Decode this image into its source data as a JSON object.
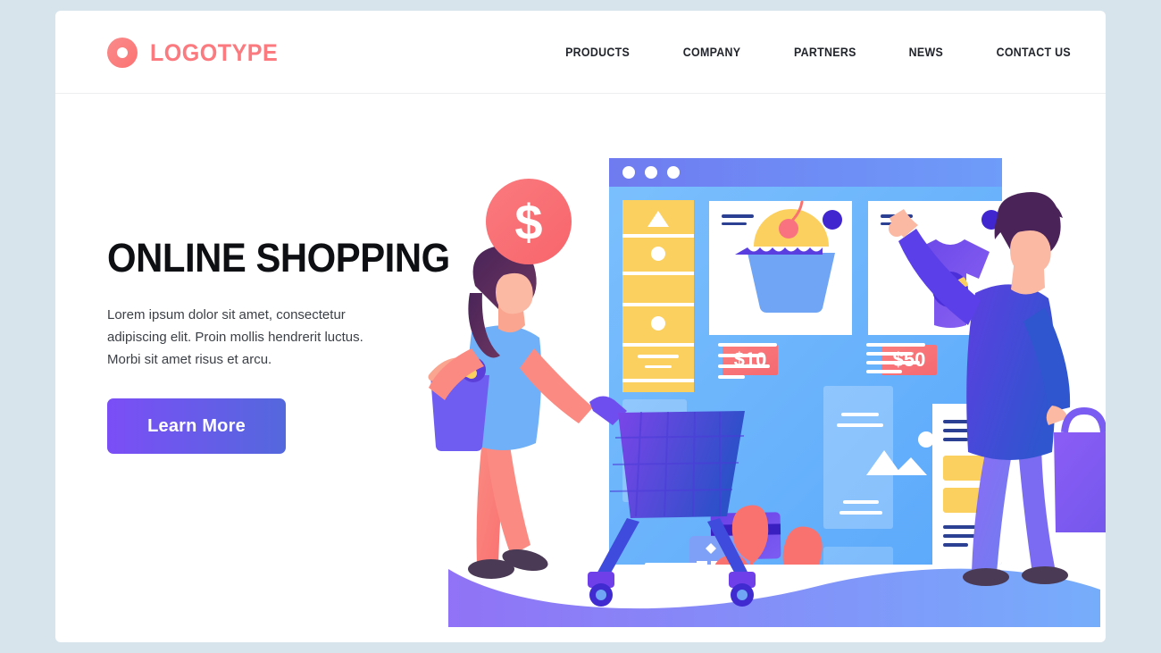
{
  "theme": {
    "page_background": "#d8e4ec",
    "card_background": "#ffffff",
    "brand_color": "#fb7a7f",
    "accent_purple": "#7b4ef6",
    "accent_blue": "#5468dd",
    "heading_color": "#0d0f12",
    "body_text_color": "#3b3f46",
    "illustration_yellow": "#fcd05f",
    "illustration_coral": "#f9726f",
    "illustration_sky": "#6cb8fb"
  },
  "header": {
    "logo": {
      "icon": "ring-circle-icon",
      "text": "LOGOTYPE"
    },
    "nav_items": [
      {
        "label": "PRODUCTS"
      },
      {
        "label": "COMPANY"
      },
      {
        "label": "PARTNERS"
      },
      {
        "label": "NEWS"
      },
      {
        "label": "CONTACT US"
      }
    ]
  },
  "hero": {
    "title": "ONLINE SHOPPING",
    "paragraph": "Lorem ipsum dolor sit amet, consectetur adipiscing elit. Proin mollis hendrerit luctus. Morbi sit amet risus et arcu.",
    "cta_label": "Learn More"
  },
  "illustration": {
    "name": "online-shopping-illustration",
    "badge": {
      "symbol": "$",
      "shape": "circle",
      "color": "#f9726f"
    },
    "browser_window": {
      "titlebar_dots": 3,
      "product_cards": [
        {
          "item": "cupcake",
          "price": "$10"
        },
        {
          "item": "t-shirt",
          "price": "$50"
        }
      ]
    },
    "characters": [
      {
        "name": "woman-with-cart",
        "items": "grocery-bag"
      },
      {
        "name": "man-with-shopping-bag",
        "items": "shopping-bag"
      }
    ]
  }
}
